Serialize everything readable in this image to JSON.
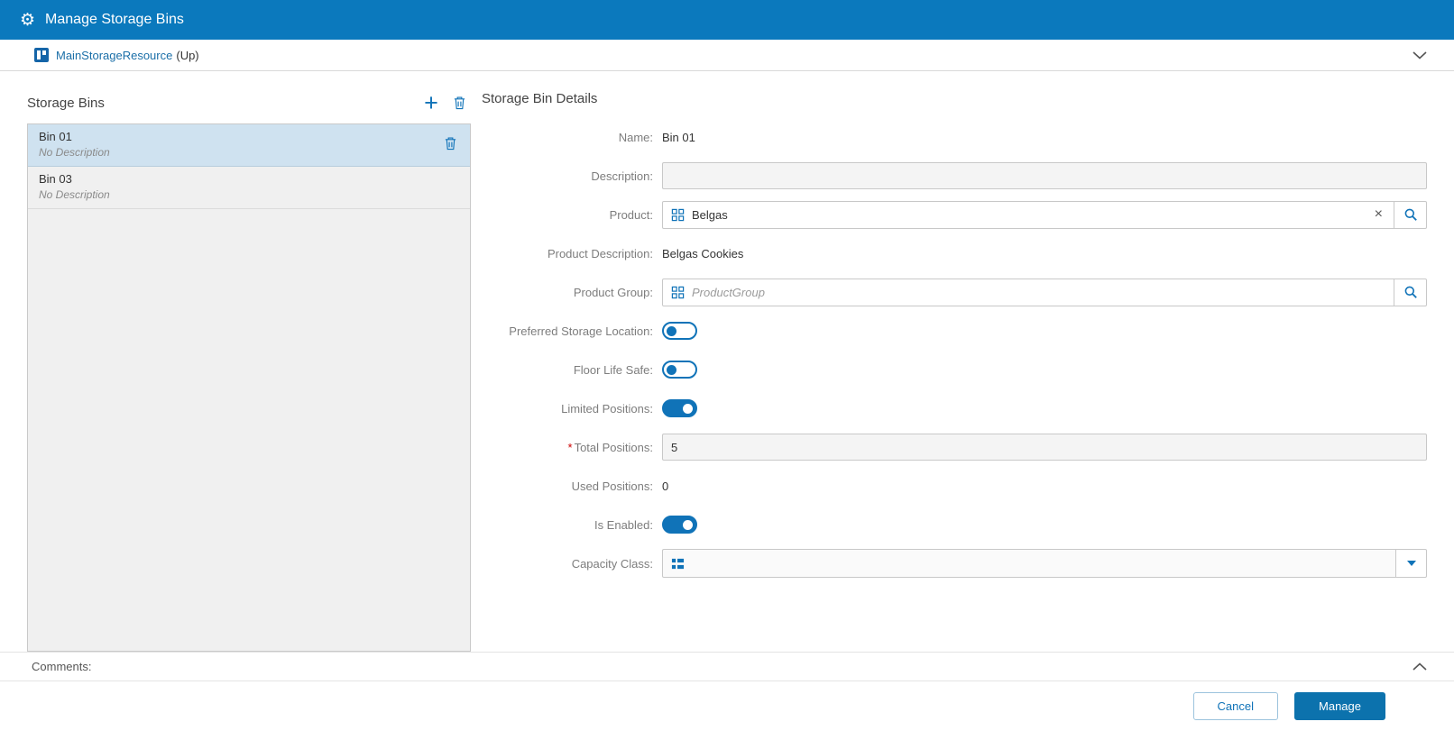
{
  "header": {
    "title": "Manage Storage Bins"
  },
  "breadcrumb": {
    "link": "MainStorageResource",
    "suffix": "(Up)"
  },
  "bins_panel": {
    "title": "Storage Bins",
    "items": [
      {
        "name": "Bin 01",
        "description": "No Description",
        "selected": true
      },
      {
        "name": "Bin 03",
        "description": "No Description",
        "selected": false
      }
    ]
  },
  "details": {
    "title": "Storage Bin Details",
    "name_label": "Name:",
    "name_value": "Bin 01",
    "description_label": "Description:",
    "description_value": "",
    "product_label": "Product:",
    "product_value": "Belgas",
    "product_description_label": "Product Description:",
    "product_description_value": "Belgas Cookies",
    "product_group_label": "Product Group:",
    "product_group_placeholder": "ProductGroup",
    "preferred_storage_label": "Preferred Storage Location:",
    "floor_life_label": "Floor Life Safe:",
    "limited_positions_label": "Limited Positions:",
    "total_positions_required_mark": "*",
    "total_positions_label": "Total Positions:",
    "total_positions_value": "5",
    "used_positions_label": "Used Positions:",
    "used_positions_value": "0",
    "is_enabled_label": "Is Enabled:",
    "capacity_class_label": "Capacity Class:",
    "toggles": {
      "preferred_storage_location": false,
      "floor_life_safe": false,
      "limited_positions": true,
      "is_enabled": true
    }
  },
  "comments": {
    "label": "Comments:"
  },
  "footer": {
    "cancel_label": "Cancel",
    "manage_label": "Manage"
  },
  "icons": {
    "gear": "⚙",
    "add": "+",
    "clear": "×"
  },
  "colors": {
    "header_bg": "#0b79bd",
    "accent": "#1073b8",
    "selected_row": "#cfe2f0",
    "required": "#cc0000"
  }
}
